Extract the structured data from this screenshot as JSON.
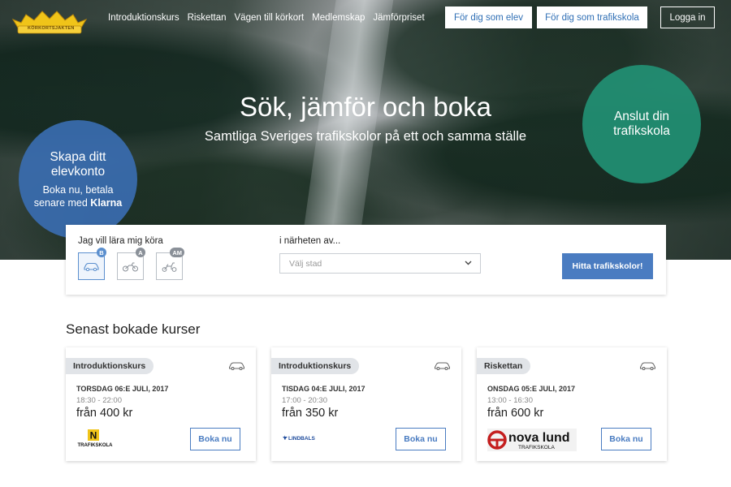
{
  "header": {
    "logo_text": "KÖRKORTSJAKTEN",
    "nav": [
      "Introduktionskurs",
      "Riskettan",
      "Vägen till körkort",
      "Medlemskap",
      "Jämförpriset"
    ],
    "btn_elev": "För dig som elev",
    "btn_skola": "För dig som trafikskola",
    "btn_login": "Logga in"
  },
  "hero": {
    "title": "Sök, jämför och boka",
    "subtitle": "Samtliga Sveriges trafikskolor på ett och samma ställe",
    "left_circle": {
      "title": "Skapa ditt elevkonto",
      "text": "Boka nu, betala senare med",
      "brand": "Klarna"
    },
    "right_circle": {
      "title": "Anslut din trafikskola"
    }
  },
  "search": {
    "drive_label": "Jag vill lära mig köra",
    "vehicles": [
      {
        "badge": "B",
        "icon": "car-icon",
        "active": true
      },
      {
        "badge": "A",
        "icon": "motorcycle-icon",
        "active": false
      },
      {
        "badge": "AM",
        "icon": "moped-icon",
        "active": false
      }
    ],
    "near_label": "i närheten av...",
    "city_placeholder": "Välj stad",
    "find_button": "Hitta trafikskolor!"
  },
  "recent": {
    "title": "Senast bokade kurser",
    "cards": [
      {
        "tag": "Introduktionskurs",
        "date": "TORSDAG 06:E JULI, 2017",
        "time": "18:30 - 22:00",
        "price": "från 400 kr",
        "book": "Boka nu",
        "school_logo": "N",
        "school_text": "TRAFIKSKOLA"
      },
      {
        "tag": "Introduktionskurs",
        "date": "TISDAG 04:E JULI, 2017",
        "time": "17:00 - 20:30",
        "price": "från 350 kr",
        "book": "Boka nu",
        "school_text": "LINDBALS"
      },
      {
        "tag": "Riskettan",
        "date": "ONSDAG 05:E JULI, 2017",
        "time": "13:00 - 16:30",
        "price": "från 600 kr",
        "book": "Boka nu",
        "school_logo": "nova lund",
        "school_text": "TRAFIKSKOLA"
      }
    ]
  },
  "colors": {
    "primary_blue": "#4a7cc1",
    "left_circle": "#3a6cb0",
    "right_circle": "#229074"
  }
}
